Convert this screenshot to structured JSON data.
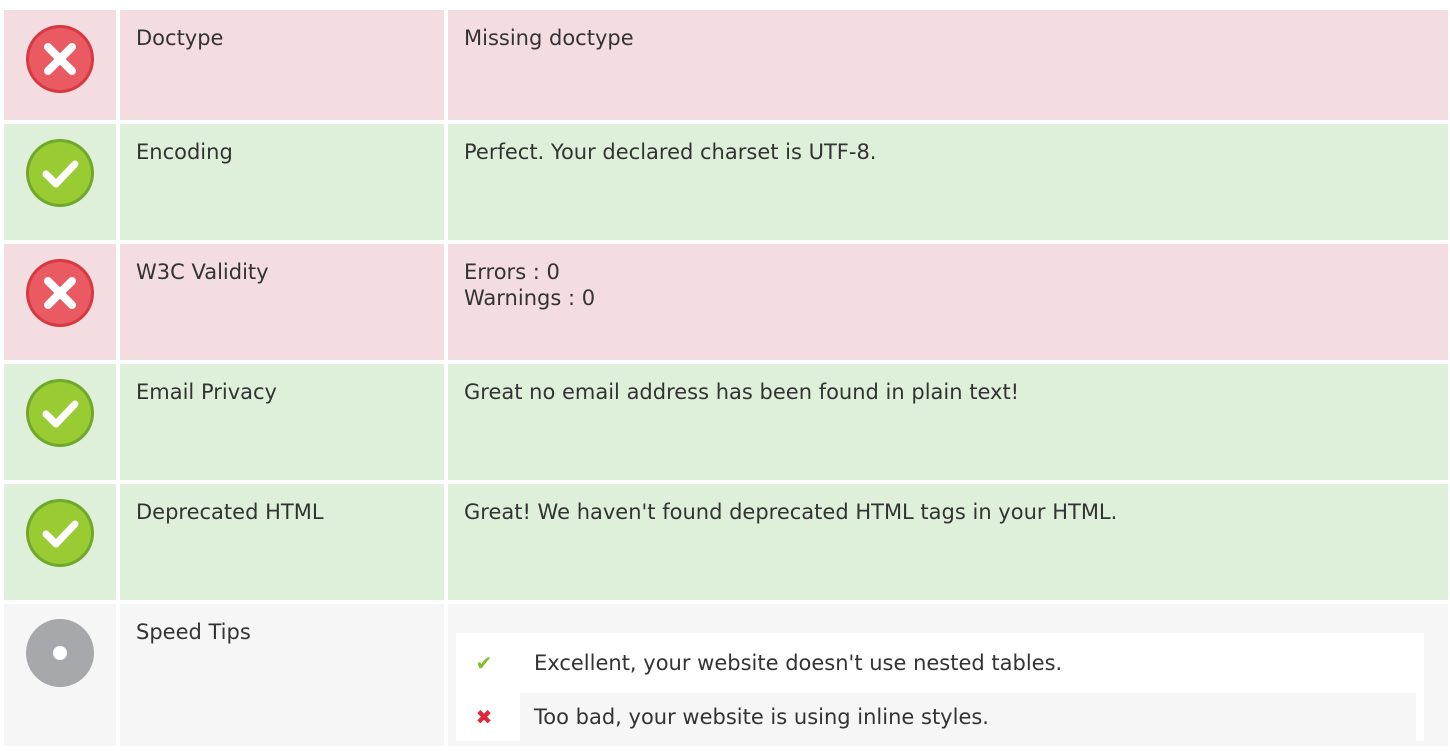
{
  "rows": [
    {
      "status": "error",
      "label": "Doctype",
      "value": [
        "Missing doctype"
      ]
    },
    {
      "status": "ok",
      "label": "Encoding",
      "value": [
        "Perfect. Your declared charset is UTF-8."
      ]
    },
    {
      "status": "error",
      "label": "W3C Validity",
      "value": [
        "Errors : 0",
        "Warnings : 0"
      ]
    },
    {
      "status": "ok",
      "label": "Email Privacy",
      "value": [
        "Great no email address has been found in plain text!"
      ]
    },
    {
      "status": "ok",
      "label": "Deprecated HTML",
      "value": [
        "Great! We haven't found deprecated HTML tags in your HTML."
      ]
    },
    {
      "status": "neutral",
      "label": "Speed Tips"
    }
  ],
  "speed_tips": [
    {
      "result": "good",
      "icon": "check-icon",
      "text": "Excellent, your website doesn't use nested tables."
    },
    {
      "result": "bad",
      "icon": "cross-icon",
      "text": "Too bad, your website is using inline styles."
    }
  ],
  "colors": {
    "error_bg": "#f3dde0",
    "ok_bg": "#dff0da",
    "neutral_bg": "#f6f6f6",
    "error_icon": "#e0434f",
    "ok_icon": "#8cc63f",
    "neutral_icon": "#a7a8ab"
  }
}
